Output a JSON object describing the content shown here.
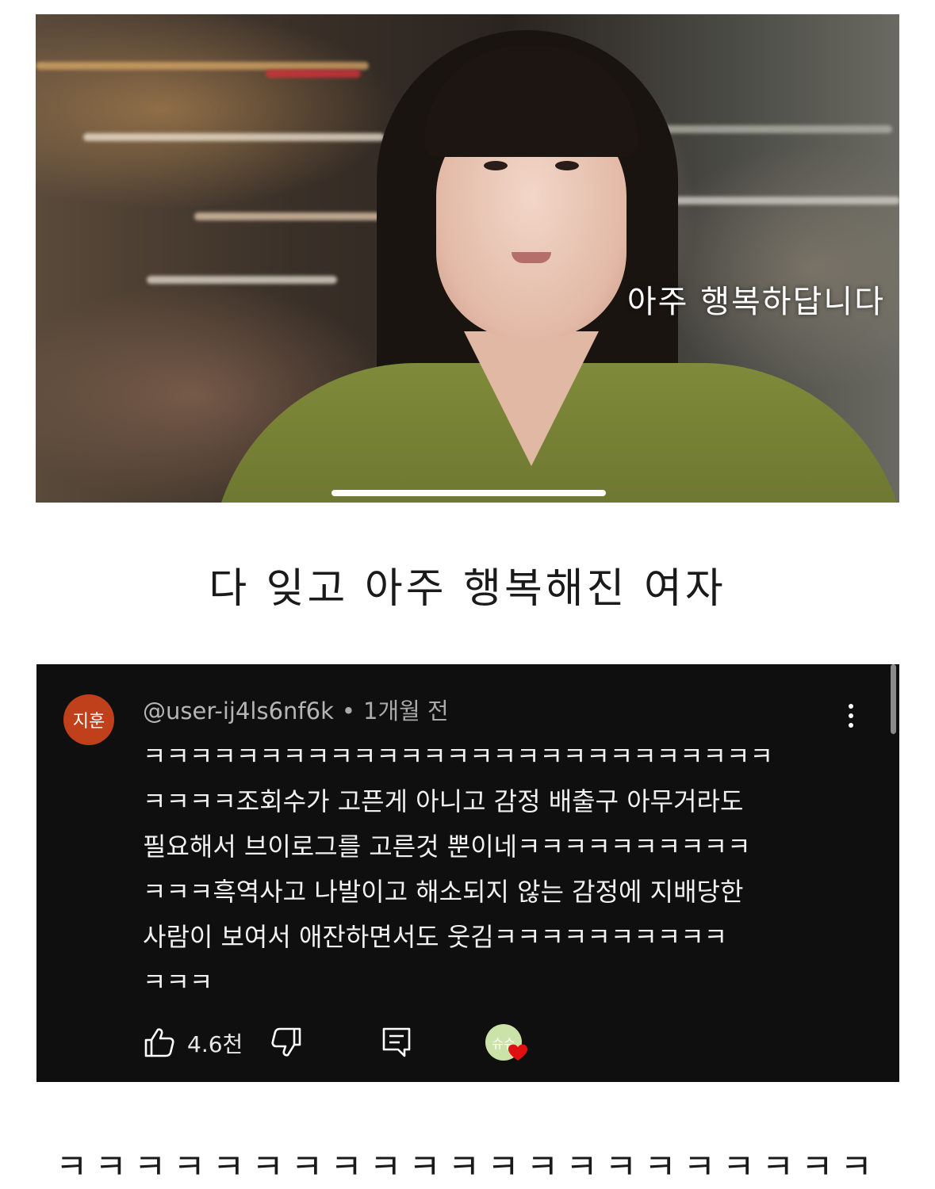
{
  "video": {
    "caption": "아주 행복하답니다"
  },
  "post": {
    "title": "다 잊고 아주 행복해진 여자"
  },
  "comment": {
    "avatar_text": "지훈",
    "handle": "@user-ij4ls6nf6k",
    "separator": "•",
    "time": "1개월 전",
    "lines": [
      "ㅋㅋㅋㅋㅋㅋㅋㅋㅋㅋㅋㅋㅋㅋㅋㅋㅋㅋㅋㅋㅋㅋㅋㅋㅋㅋㅋ",
      "ㅋㅋㅋㅋ조회수가 고픈게 아니고 감정 배출구 아무거라도",
      "필요해서 브이로그를 고른것 뿐이네ㅋㅋㅋㅋㅋㅋㅋㅋㅋㅋ",
      "ㅋㅋㅋ흑역사고 나발이고 해소되지 않는 감정에 지배당한",
      "사람이 보여서 애잔하면서도 웃김ㅋㅋㅋㅋㅋㅋㅋㅋㅋㅋ",
      "ㅋㅋㅋ"
    ],
    "like_count": "4.6천",
    "creator_avatar_text": "슈슈"
  },
  "footer": {
    "laugh_text": "ㅋㅋㅋㅋㅋㅋㅋㅋㅋㅋㅋㅋㅋㅋㅋㅋㅋㅋㅋㅋㅋ"
  },
  "colors": {
    "comment_bg": "#0f0f0f",
    "avatar_bg": "#c0401c",
    "heart": "#e01010"
  },
  "icons": [
    "thumbs-up-icon",
    "thumbs-down-icon",
    "reply-icon",
    "more-vert-icon",
    "heart-icon"
  ]
}
